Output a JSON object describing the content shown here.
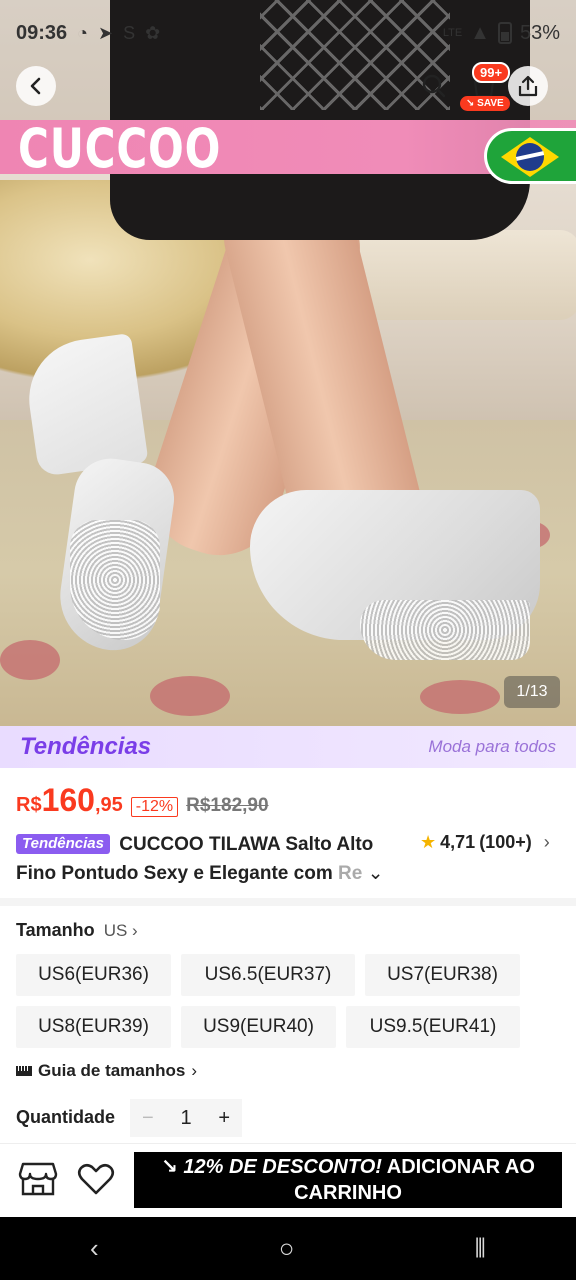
{
  "status_bar": {
    "time": "09:36",
    "network": "LTE",
    "battery": "53%"
  },
  "nav": {
    "cart_badge": "99+",
    "save_badge": "SAVE"
  },
  "hero": {
    "brand": "CUCCOO",
    "image_counter": "1/13"
  },
  "trends": {
    "logo": "Tendências",
    "tagline": "Moda para todos"
  },
  "price": {
    "currency": "R$",
    "integer": "160",
    "decimal": ",95",
    "discount": "-12%",
    "original": "R$182,90"
  },
  "product": {
    "tag": "Tendências",
    "title_line1": "CUCCOO TILAWA Salto Alto",
    "title_line2": "Fino Pontudo Sexy e Elegante com ",
    "title_fade": "Re",
    "rating": "4,71",
    "reviews": "(100+)"
  },
  "size": {
    "label": "Tamanho",
    "unit": "US",
    "options": [
      "US6(EUR36)",
      "US6.5(EUR37)",
      "US7(EUR38)",
      "US8(EUR39)",
      "US9(EUR40)",
      "US9.5(EUR41)"
    ],
    "guide": "Guia de tamanhos"
  },
  "quantity": {
    "label": "Quantidade",
    "value": "1",
    "minus": "−",
    "plus": "+"
  },
  "action": {
    "promo": "12% DE DESCONTO!",
    "label_rest": "ADICIONAR AO",
    "label_line2": "CARRINHO"
  },
  "colors": {
    "price": "#fa3a1f",
    "brand_strip": "#ef85b3",
    "trends_purple": "#7a3ee8",
    "add_to_cart_bg": "#000000"
  }
}
